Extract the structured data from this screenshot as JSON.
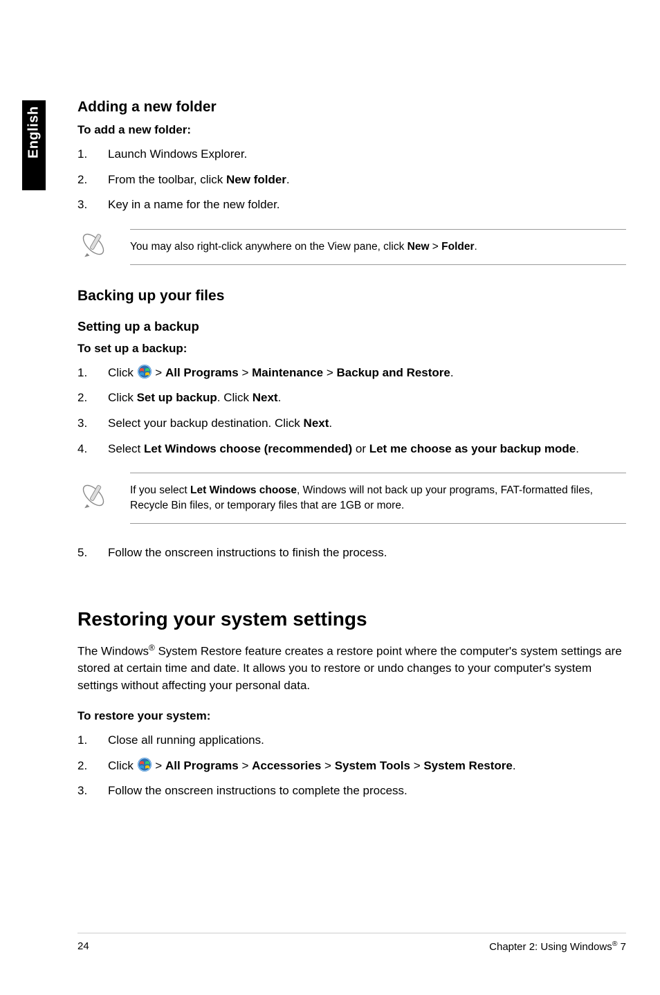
{
  "sidebar": {
    "lang": "English"
  },
  "section1": {
    "heading": "Adding a new folder",
    "intro": "To add a new folder:",
    "steps": {
      "s1": "Launch Windows Explorer.",
      "s2_pre": "From the toolbar, click ",
      "s2_b": "New folder",
      "s2_post": ".",
      "s3": "Key in a name for the new folder."
    },
    "note_pre": "You may also right-click anywhere on the View pane, click ",
    "note_b1": "New",
    "note_mid": " > ",
    "note_b2": "Folder",
    "note_post": "."
  },
  "section2": {
    "heading": "Backing up your files",
    "subheading": "Setting up a backup",
    "intro": "To set up a backup:",
    "steps": {
      "s1_pre": "Click ",
      "s1_post": " > ",
      "s1_b1": "All Programs",
      "s1_mid1": " > ",
      "s1_b2": "Maintenance",
      "s1_mid2": " > ",
      "s1_b3": "Backup and Restore",
      "s1_end": ".",
      "s2_pre": "Click ",
      "s2_b1": "Set up backup",
      "s2_mid": ". Click ",
      "s2_b2": "Next",
      "s2_end": ".",
      "s3_pre": "Select your backup destination. Click ",
      "s3_b": "Next",
      "s3_end": ".",
      "s4_pre": "Select ",
      "s4_b1": "Let Windows choose (recommended)",
      "s4_mid": " or ",
      "s4_b2": "Let me choose as your backup mode",
      "s4_end": "."
    },
    "note_pre": "If you select ",
    "note_b": "Let Windows choose",
    "note_post": ", Windows will not back up your programs, FAT-formatted files, Recycle Bin files, or temporary files that are 1GB or more.",
    "step5": "Follow the onscreen instructions to finish the process."
  },
  "section3": {
    "heading": "Restoring your system settings",
    "para_pre": "The Windows",
    "para_sup": "®",
    "para_post": " System Restore feature creates a restore point where the computer's system settings are stored at certain time and date. It allows you to restore or undo changes to your computer's system settings without affecting your personal data.",
    "intro": "To restore your system:",
    "steps": {
      "s1": "Close all running applications.",
      "s2_pre": "Click ",
      "s2_post": " > ",
      "s2_b1": "All Programs",
      "s2_m1": " > ",
      "s2_b2": "Accessories",
      "s2_m2": " > ",
      "s2_b3": "System Tools",
      "s2_m3": " > ",
      "s2_b4": "System Restore",
      "s2_end": ".",
      "s3": "Follow the onscreen instructions to complete the process."
    }
  },
  "footer": {
    "page": "24",
    "chapter_pre": "Chapter 2: Using Windows",
    "chapter_sup": "®",
    "chapter_post": " 7"
  }
}
